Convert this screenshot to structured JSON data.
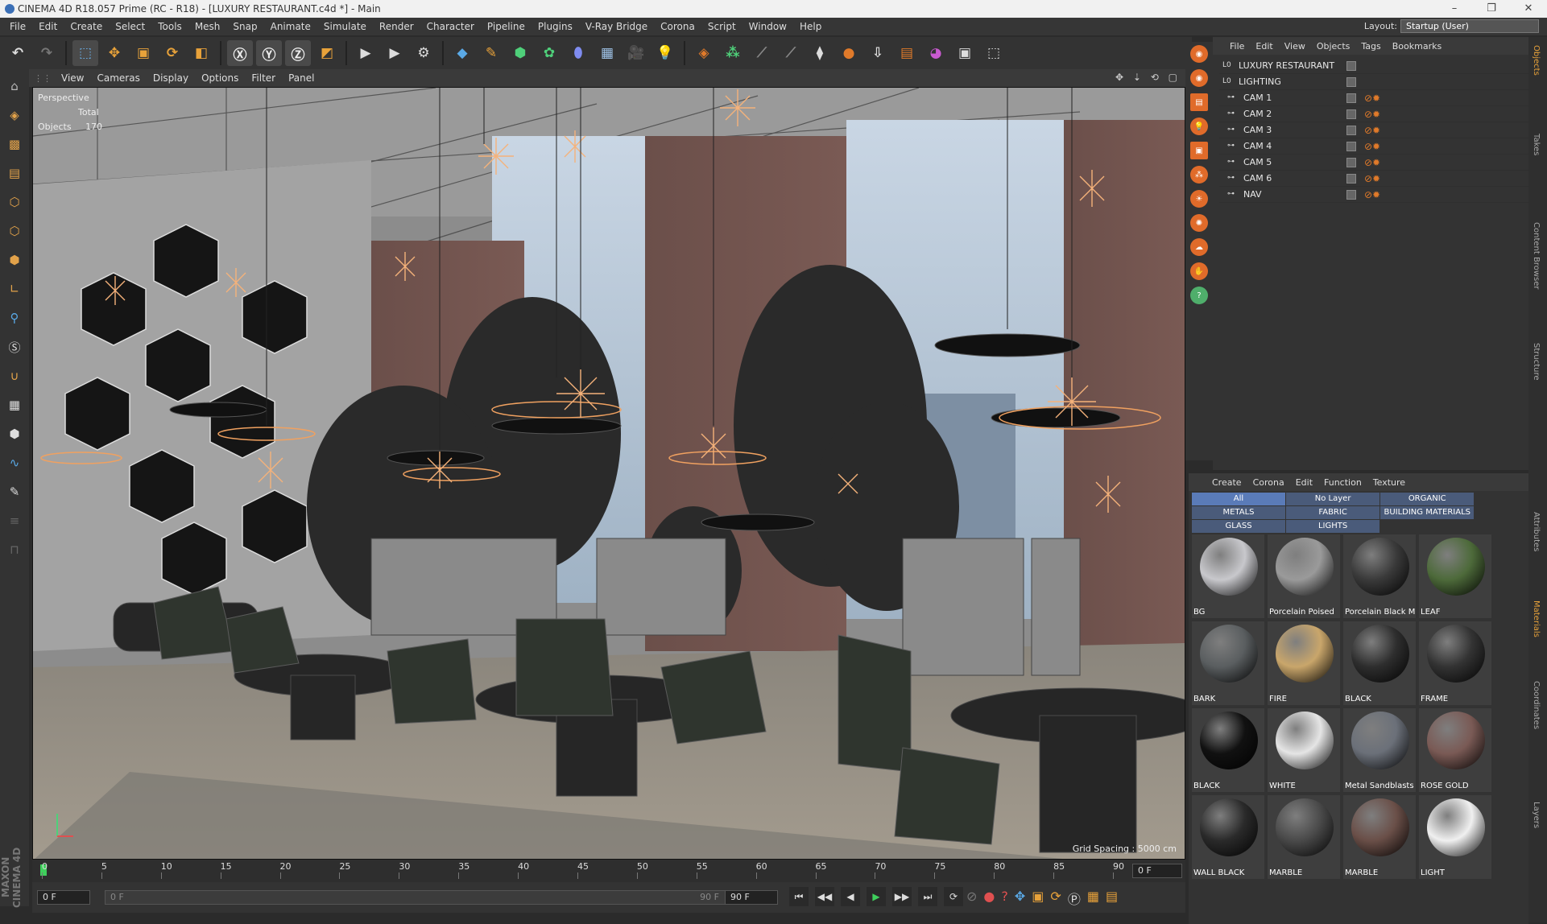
{
  "window": {
    "title": "CINEMA 4D R18.057 Prime (RC - R18) - [LUXURY RESTAURANT.c4d *] - Main",
    "controls": [
      "–",
      "❐",
      "✕"
    ]
  },
  "menu": [
    "File",
    "Edit",
    "Create",
    "Select",
    "Tools",
    "Mesh",
    "Snap",
    "Animate",
    "Simulate",
    "Render",
    "Character",
    "Pipeline",
    "Plugins",
    "V-Ray Bridge",
    "Corona",
    "Script",
    "Window",
    "Help"
  ],
  "layout": {
    "label": "Layout:",
    "value": "Startup (User)"
  },
  "viewport": {
    "menu": [
      "View",
      "Cameras",
      "Display",
      "Options",
      "Filter",
      "Panel"
    ],
    "label": "Perspective",
    "total_label": "Total",
    "objects_label": "Objects",
    "objects_count": "170",
    "grid_spacing": "Grid Spacing : 5000 cm",
    "nav_icons": "✥ ⇣ ⟲ ▢"
  },
  "timeline": {
    "ticks": [
      "0",
      "5",
      "10",
      "15",
      "20",
      "25",
      "30",
      "35",
      "40",
      "45",
      "50",
      "55",
      "60",
      "65",
      "70",
      "75",
      "80",
      "85",
      "90"
    ],
    "current": "0 F",
    "start": "0 F",
    "range_start": "0 F",
    "range_end": "90 F",
    "end": "90 F"
  },
  "transport": {
    "buttons": [
      "⏮",
      "◀◀",
      "◀",
      "▶",
      "▶▶",
      "⏭",
      "⟳"
    ]
  },
  "objects": {
    "menu": [
      "File",
      "Edit",
      "View",
      "Objects",
      "Tags",
      "Bookmarks"
    ],
    "items": [
      {
        "name": "LUXURY RESTAURANT",
        "type": "null"
      },
      {
        "name": "LIGHTING",
        "type": "null"
      },
      {
        "name": "CAM 1",
        "type": "camera"
      },
      {
        "name": "CAM 2",
        "type": "camera"
      },
      {
        "name": "CAM 3",
        "type": "camera"
      },
      {
        "name": "CAM 4",
        "type": "camera"
      },
      {
        "name": "CAM 5",
        "type": "camera"
      },
      {
        "name": "CAM 6",
        "type": "camera"
      },
      {
        "name": "NAV",
        "type": "camera"
      }
    ]
  },
  "materials": {
    "menu": [
      "Create",
      "Corona",
      "Edit",
      "Function",
      "Texture"
    ],
    "layers": [
      "All",
      "No Layer",
      "ORGANIC",
      "METALS",
      "FABRIC",
      "BUILDING MATERIALS",
      "GLASS",
      "LIGHTS"
    ],
    "items": [
      {
        "name": "BG",
        "color": "#c8c8cc"
      },
      {
        "name": "Porcelain Poised",
        "color": "#9a9a9a"
      },
      {
        "name": "Porcelain Black M",
        "color": "#3a3a3a"
      },
      {
        "name": "LEAF",
        "color": "#4d6a3a"
      },
      {
        "name": "BARK",
        "color": "#5a5e60"
      },
      {
        "name": "FIRE",
        "color": "#c9a66b"
      },
      {
        "name": "BLACK",
        "color": "#2e2e2e"
      },
      {
        "name": "FRAME",
        "color": "#333333"
      },
      {
        "name": "BLACK",
        "color": "#111111"
      },
      {
        "name": "WHITE",
        "color": "#e5e5e5"
      },
      {
        "name": "Metal Sandblasts",
        "color": "#6b7079"
      },
      {
        "name": "ROSE GOLD",
        "color": "#7a5a55"
      },
      {
        "name": "WALL BLACK",
        "color": "#2a2a2a"
      },
      {
        "name": "MARBLE",
        "color": "#4a4a4a"
      },
      {
        "name": "MARBLE",
        "color": "#6a4f48"
      },
      {
        "name": "LIGHT",
        "color": "#f0f0f0"
      }
    ]
  },
  "side_tabs": [
    "Objects",
    "Takes",
    "Content Browser",
    "Structure",
    "Attributes",
    "Materials",
    "Coordinates",
    "Layers"
  ],
  "brand": "MAXON CINEMA 4D"
}
